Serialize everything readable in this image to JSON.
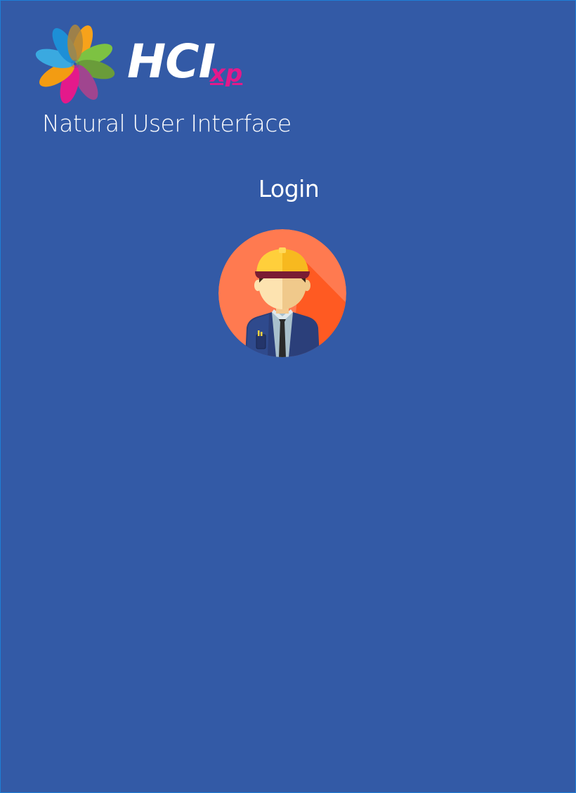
{
  "app": {
    "logo_text": "HCI",
    "logo_suffix": "xp",
    "tagline": "Natural User Interface"
  },
  "login": {
    "title": "Login"
  },
  "user": {
    "avatar_icon": "worker-avatar-icon"
  },
  "colors": {
    "background": "#335aa6",
    "accent": "#e4198b",
    "avatar_bg": "#ff7a50"
  }
}
